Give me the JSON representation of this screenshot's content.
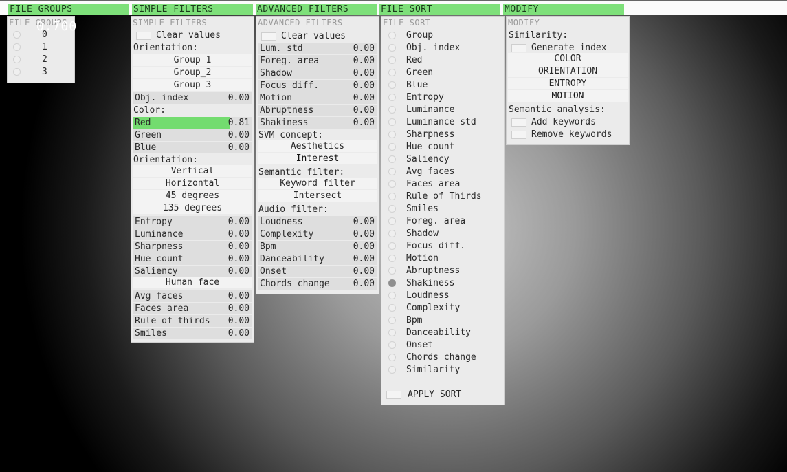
{
  "tabs": {
    "file_groups": "FILE GROUPS",
    "simple_filters": "SIMPLE FILTERS",
    "advanced_filters": "ADVANCED FILTERS",
    "file_sort": "FILE SORT",
    "modify": "MODIFY"
  },
  "file_groups": {
    "title": "FILE GROUPS",
    "overlay_value": "0.700",
    "items": [
      "0",
      "1",
      "2",
      "3"
    ]
  },
  "simple": {
    "title": "SIMPLE FILTERS",
    "clear": "Clear values",
    "orientation1": "Orientation:",
    "group1": "Group 1",
    "group2": "Group_2",
    "group3": "Group 3",
    "obj_index": {
      "label": "Obj. index",
      "value": "0.00"
    },
    "color": "Color:",
    "red": {
      "label": "Red",
      "value": "0.81",
      "fill": 0.81
    },
    "green": {
      "label": "Green",
      "value": "0.00"
    },
    "blue": {
      "label": "Blue",
      "value": "0.00"
    },
    "orientation2": "Orientation:",
    "vertical": "Vertical",
    "horizontal": "Horizontal",
    "deg45": "45 degrees",
    "deg135": "135 degrees",
    "entropy": {
      "label": "Entropy",
      "value": "0.00"
    },
    "luminance": {
      "label": "Luminance",
      "value": "0.00"
    },
    "sharpness": {
      "label": "Sharpness",
      "value": "0.00"
    },
    "hue_count": {
      "label": "Hue count",
      "value": "0.00"
    },
    "saliency": {
      "label": "Saliency",
      "value": "0.00"
    },
    "human_face": "Human face",
    "avg_faces": {
      "label": "Avg faces",
      "value": "0.00"
    },
    "faces_area": {
      "label": "Faces area",
      "value": "0.00"
    },
    "rule_thirds": {
      "label": "Rule of thirds",
      "value": "0.00"
    },
    "smiles": {
      "label": "Smiles",
      "value": "0.00"
    }
  },
  "advanced": {
    "title": "ADVANCED FILTERS",
    "clear": "Clear values",
    "lum_std": {
      "label": "Lum. std",
      "value": "0.00"
    },
    "foreg_area": {
      "label": "Foreg. area",
      "value": "0.00"
    },
    "shadow": {
      "label": "Shadow",
      "value": "0.00"
    },
    "focus_diff": {
      "label": "Focus diff.",
      "value": "0.00"
    },
    "motion": {
      "label": "Motion",
      "value": "0.00"
    },
    "abruptness": {
      "label": "Abruptness",
      "value": "0.00"
    },
    "shakiness": {
      "label": "Shakiness",
      "value": "0.00"
    },
    "svm": "SVM concept:",
    "aesthetics": "Aesthetics",
    "interest": "Interest",
    "semantic": "Semantic filter:",
    "keyword_filter": "Keyword filter",
    "intersect": "Intersect",
    "audio": "Audio filter:",
    "loudness": {
      "label": "Loudness",
      "value": "0.00"
    },
    "complexity": {
      "label": "Complexity",
      "value": "0.00"
    },
    "bpm": {
      "label": "Bpm",
      "value": "0.00"
    },
    "danceability": {
      "label": "Danceability",
      "value": "0.00"
    },
    "onset": {
      "label": "Onset",
      "value": "0.00"
    },
    "chords": {
      "label": "Chords change",
      "value": "0.00"
    }
  },
  "sort": {
    "title": "FILE SORT",
    "selected": "Shakiness",
    "items": [
      "Group",
      "Obj. index",
      "Red",
      "Green",
      "Blue",
      "Entropy",
      "Luminance",
      "Luminance std",
      "Sharpness",
      "Hue count",
      "Saliency",
      "Avg faces",
      "Faces area",
      "Rule of Thirds",
      "Smiles",
      "Foreg. area",
      "Shadow",
      "Focus diff.",
      "Motion",
      "Abruptness",
      "Shakiness",
      "Loudness",
      "Complexity",
      "Bpm",
      "Danceability",
      "Onset",
      "Chords change",
      "Similarity"
    ],
    "apply": "APPLY SORT"
  },
  "modify": {
    "title": "MODIFY",
    "similarity": "Similarity:",
    "generate_index": "Generate index",
    "color": "COLOR",
    "orientation": "ORIENTATION",
    "entropy": "ENTROPY",
    "motion": "MOTION",
    "semantic": "Semantic analysis:",
    "add_keywords": "Add keywords",
    "remove_keywords": "Remove keywords"
  }
}
